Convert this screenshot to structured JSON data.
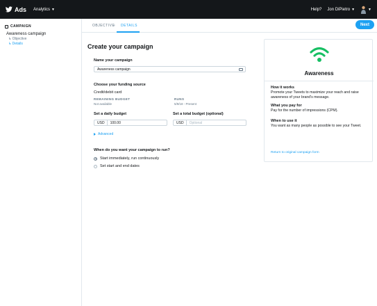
{
  "topbar": {
    "brand": "Ads",
    "analytics": "Analytics",
    "help": "Help?",
    "user_name": "Jon DiPietro"
  },
  "sidebar": {
    "section_title": "CAMPAIGN",
    "campaign_name": "Awareness campaign",
    "items": [
      {
        "label": "Objective"
      },
      {
        "label": "Details"
      }
    ]
  },
  "tabs": {
    "objective": "OBJECTIVE",
    "separator": ">",
    "details": "DETAILS"
  },
  "next_label": "Next",
  "form": {
    "page_title": "Create your campaign",
    "name_label": "Name your campaign",
    "name_value": "Awareness campaign",
    "funding_label": "Choose your funding source",
    "funding_value": "Credit/debit card",
    "remaining_budget_head": "REMAINING BUDGET",
    "remaining_budget_value": "Not available",
    "runs_head": "RUNS",
    "runs_value": "5/9/18 - Present",
    "daily_budget_label": "Set a daily budget",
    "daily_currency": "USD",
    "daily_value": "100.00",
    "total_budget_label": "Set a total budget (optional)",
    "total_currency": "USD",
    "total_placeholder": "Optional",
    "advanced": "Advanced",
    "schedule_label": "When do you want your campaign to run?",
    "schedule_options": [
      {
        "label": "Start immediately, run continuously",
        "selected": true
      },
      {
        "label": "Set start and end dates",
        "selected": false
      }
    ]
  },
  "objective_card": {
    "title": "Awareness",
    "icon": "wifi-signal-icon",
    "icon_color": "#17bf63",
    "how_head": "How it works",
    "how_body": "Promote your Tweets to maximize your reach and raise awareness of your brand's message.",
    "pay_head": "What you pay for",
    "pay_body": "Pay for the number of impressions (CPM).",
    "when_head": "When to use it",
    "when_body": "You want as many people as possible to see your Tweet.",
    "return_link": "Return to original campaign form"
  },
  "colors": {
    "accent": "#1da1f2",
    "topbar": "#14171a",
    "success": "#17bf63"
  }
}
